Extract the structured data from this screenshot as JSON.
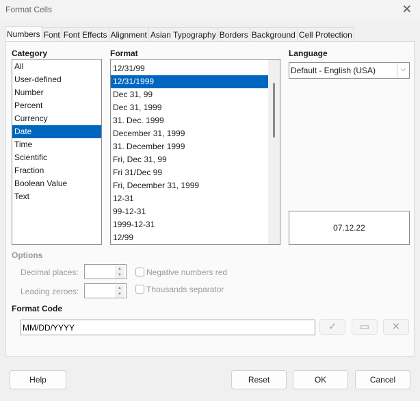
{
  "window": {
    "title": "Format Cells",
    "close_icon": "close-icon"
  },
  "tabs": [
    "Numbers",
    "Font",
    "Font Effects",
    "Alignment",
    "Asian Typography",
    "Borders",
    "Background",
    "Cell Protection"
  ],
  "category": {
    "label": "Category",
    "items": [
      "All",
      "User-defined",
      "Number",
      "Percent",
      "Currency",
      "Date",
      "Time",
      "Scientific",
      "Fraction",
      "Boolean Value",
      "Text"
    ],
    "selected": "Date"
  },
  "format": {
    "label": "Format",
    "items": [
      "12/31/99",
      "12/31/1999",
      "Dec 31, 99",
      "Dec 31, 1999",
      "31. Dec. 1999",
      "December 31, 1999",
      "31. December 1999",
      "Fri, Dec 31, 99",
      "Fri 31/Dec 99",
      "Fri, December 31, 1999",
      "12-31",
      "99-12-31",
      "1999-12-31",
      "12/99"
    ],
    "selected": "12/31/1999"
  },
  "language": {
    "label": "Language",
    "value": "Default - English (USA)"
  },
  "preview": "07.12.22",
  "options": {
    "label": "Options",
    "decimal_places": "Decimal places:",
    "leading_zeroes": "Leading zeroes:",
    "negative_red": "Negative numbers red",
    "thousands_sep": "Thousands separator"
  },
  "format_code": {
    "label": "Format Code",
    "value": "MM/DD/YYYY"
  },
  "buttons": {
    "help": "Help",
    "reset": "Reset",
    "ok": "OK",
    "cancel": "Cancel"
  }
}
